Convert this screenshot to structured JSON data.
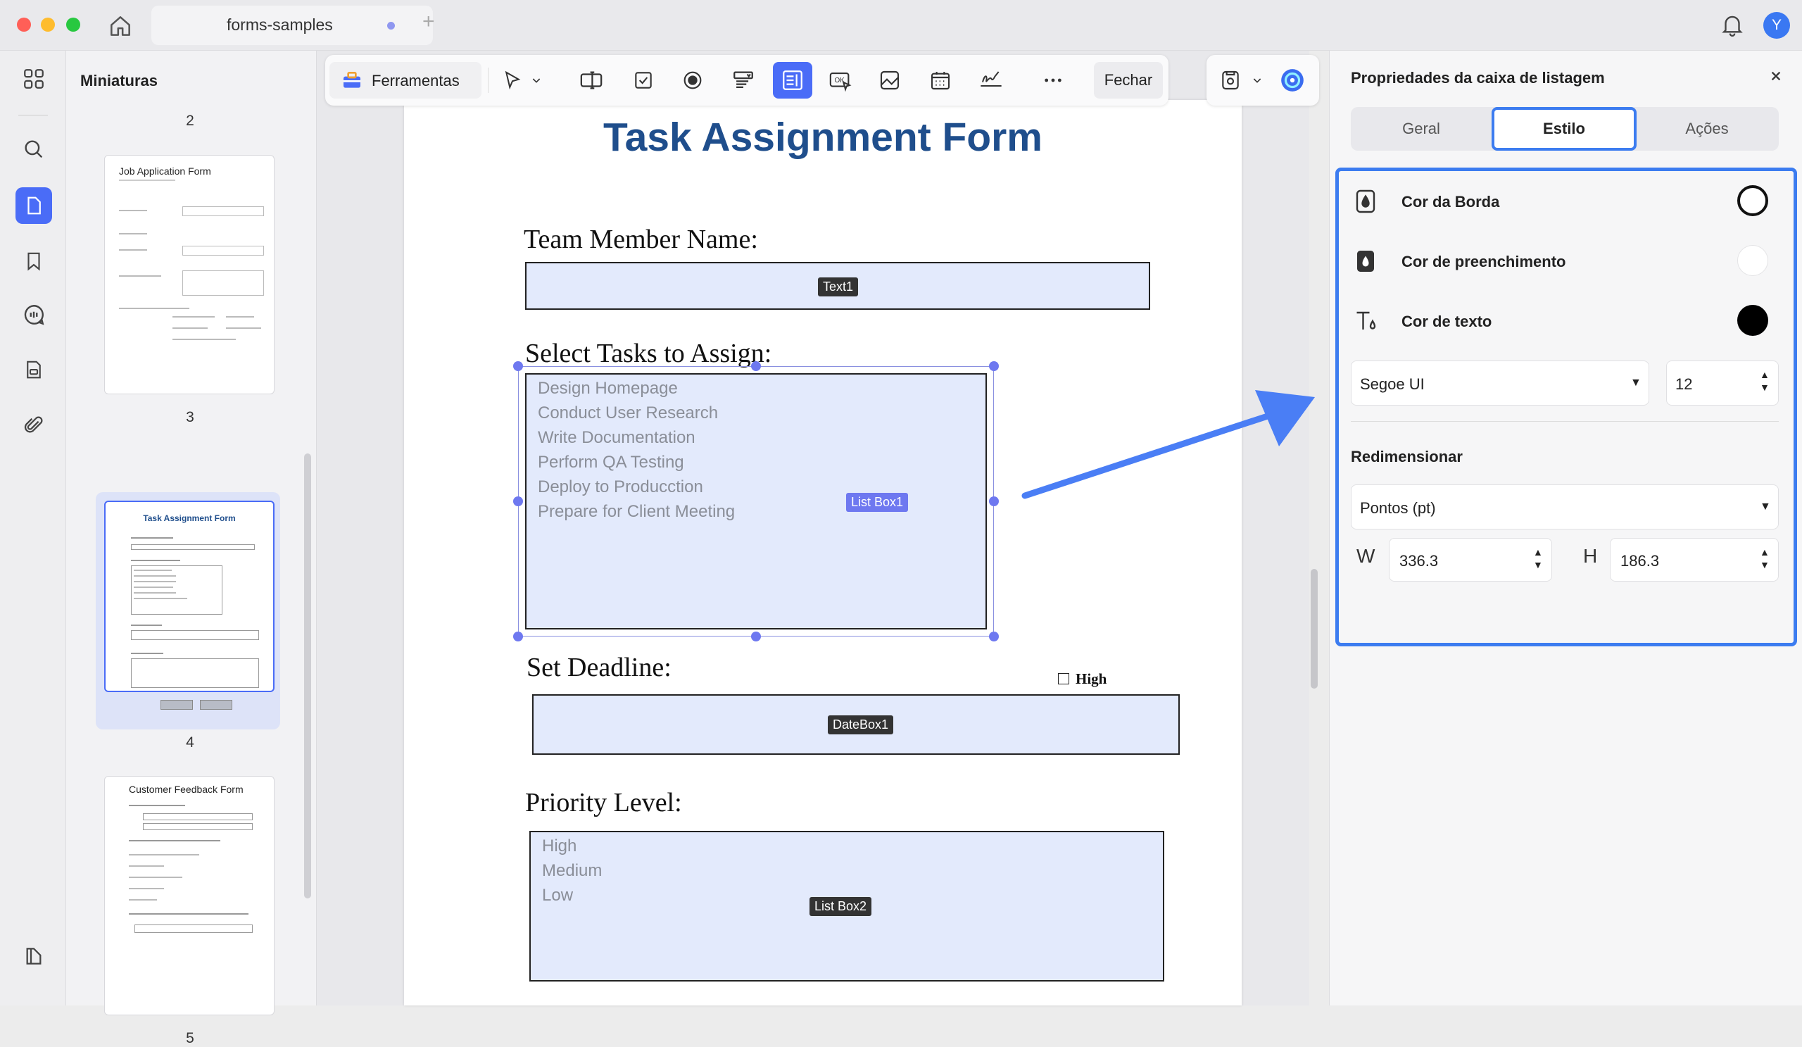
{
  "window": {
    "tab_title": "forms-samples",
    "avatar_initial": "Y"
  },
  "thumbnails": {
    "title": "Miniaturas",
    "page_numbers": [
      "2",
      "3",
      "4",
      "5"
    ],
    "thumb3": {
      "title": "Job Application Form"
    },
    "thumb4": {
      "title": "Task Assignment Form"
    },
    "thumb5": {
      "title": "Customer Feedback Form"
    }
  },
  "toolbar": {
    "tools_label": "Ferramentas",
    "close_label": "Fechar"
  },
  "form": {
    "title": "Task Assignment Form",
    "team_label": "Team Member Name:",
    "text1_tag": "Text1",
    "tasks_label": "Select Tasks to Assign:",
    "tasks": [
      "Design Homepage",
      "Conduct User Research",
      "Write Documentation",
      "Perform QA Testing",
      "Deploy to Producction",
      "Prepare for Client Meeting"
    ],
    "listbox1_tag": "List Box1",
    "deadline_label": "Set Deadline:",
    "high_checkbox": "High",
    "datebox_tag": "DateBox1",
    "priority_label": "Priority Level:",
    "priorities": [
      "High",
      "Medium",
      "Low"
    ],
    "listbox2_tag": "List Box2"
  },
  "panel": {
    "title": "Propriedades da caixa de listagem",
    "tabs": [
      "Geral",
      "Estilo",
      "Ações"
    ],
    "active_tab": "Estilo",
    "border_color_label": "Cor da Borda",
    "fill_color_label": "Cor de preenchimento",
    "text_color_label": "Cor de texto",
    "font": "Segoe UI",
    "font_size": "12",
    "resize_label": "Redimensionar",
    "unit": "Pontos (pt)",
    "w_label": "W",
    "w_value": "336.3",
    "h_label": "H",
    "h_value": "186.3"
  },
  "colors": {
    "accent": "#4a6cf7",
    "highlight_border": "#3c7cf0",
    "field_fill": "#e3eafc",
    "title_blue": "#1f4e8c"
  }
}
